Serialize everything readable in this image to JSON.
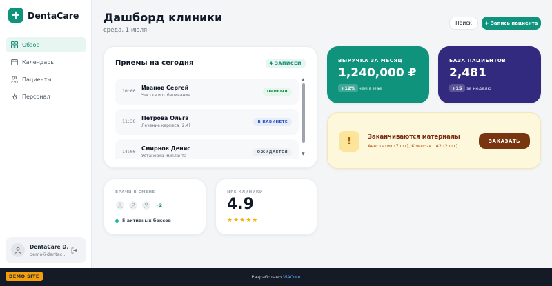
{
  "brand": {
    "name": "DentaCare"
  },
  "sidebar": {
    "items": [
      {
        "label": "Обзор",
        "icon": "grid-icon"
      },
      {
        "label": "Календарь",
        "icon": "calendar-icon"
      },
      {
        "label": "Пациенты",
        "icon": "users-icon"
      },
      {
        "label": "Персонал",
        "icon": "stethoscope-icon"
      }
    ],
    "active_index": 0,
    "user": {
      "name": "DentaCare D...",
      "email": "demo@dentac..."
    }
  },
  "header": {
    "title": "Дашборд клиники",
    "date": "среда, 1 июля",
    "search_label": "Поиск",
    "add_label": "+ Запись пациента"
  },
  "appointments": {
    "title": "Приемы на сегодня",
    "count": "4 ЗАПИСЕЙ",
    "rows": [
      {
        "time": "10:00",
        "name": "Иванов Сергей",
        "procedure": "Чистка и отбеливание",
        "status": "ПРИБЫЛ"
      },
      {
        "time": "11:30",
        "name": "Петрова Ольга",
        "procedure": "Лечение кариеса (2.4)",
        "status": "В КАБИНЕТЕ"
      },
      {
        "time": "14:00",
        "name": "Смирнов Денис",
        "procedure": "Установка импланта",
        "status": "ОЖИДАЕТСЯ"
      }
    ]
  },
  "revenue": {
    "label": "ВЫРУЧКА ЗА МЕСЯЦ",
    "value": "1,240,000 ₽",
    "delta": "+12%",
    "note": "чем в мае",
    "color": "#10937c"
  },
  "patients": {
    "label": "БАЗА ПАЦИЕНТОВ",
    "value": "2,481",
    "delta": "+15",
    "note": "за неделю",
    "color": "#322a7e"
  },
  "alert": {
    "icon": "!",
    "title": "Заканчиваются материалы",
    "text": "Анестетик (7 шт), Композит А2 (2 шт)",
    "button": "ЗАКАЗАТЬ"
  },
  "doctors": {
    "label": "ВРАЧИ В СМЕНЕ",
    "more": "+2",
    "boxes": "5 активных боксов"
  },
  "nps": {
    "label": "NPS КЛИНИКИ",
    "value": "4.9",
    "stars": "★★★★★",
    "rating": 5
  },
  "footer": {
    "badge": "DEMO SITE",
    "text": "Разработано ",
    "link": "ViACore"
  }
}
